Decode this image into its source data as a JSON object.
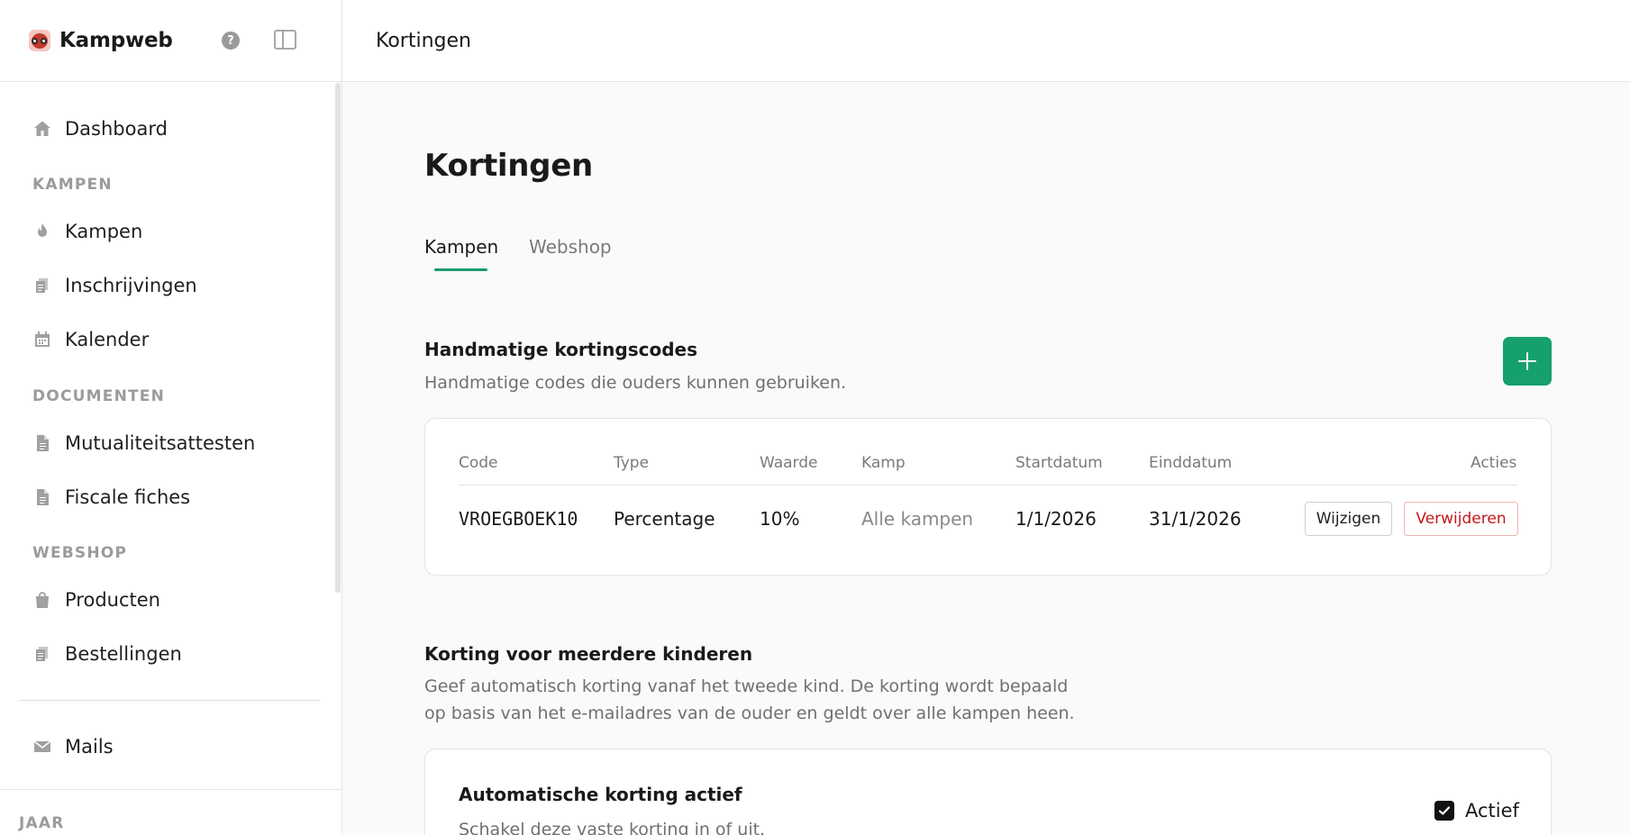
{
  "sidebar": {
    "brand": "Kampweb",
    "nav": {
      "dashboard": "Dashboard",
      "kampen": "Kampen",
      "inschrijvingen": "Inschrijvingen",
      "kalender": "Kalender",
      "mutualiteitsattesten": "Mutualiteitsattesten",
      "fiscale_fiches": "Fiscale fiches",
      "producten": "Producten",
      "bestellingen": "Bestellingen",
      "mails": "Mails"
    },
    "sections": {
      "kampen": "KAMPEN",
      "documenten": "DOCUMENTEN",
      "webshop": "WEBSHOP",
      "jaar": "JAAR"
    }
  },
  "topbar": {
    "title": "Kortingen"
  },
  "main": {
    "title": "Kortingen",
    "tabs": [
      {
        "label": "Kampen",
        "active": true
      },
      {
        "label": "Webshop",
        "active": false
      }
    ],
    "manual": {
      "title": "Handmatige kortingscodes",
      "description": "Handmatige codes die ouders kunnen gebruiken.",
      "columns": {
        "code": "Code",
        "type": "Type",
        "value": "Waarde",
        "camp": "Kamp",
        "start": "Startdatum",
        "end": "Einddatum",
        "actions": "Acties"
      },
      "rows": [
        {
          "code": "VROEGBOEK10",
          "type": "Percentage",
          "value": "10%",
          "camp": "Alle kampen",
          "start": "1/1/2026",
          "end": "31/1/2026",
          "edit": "Wijzigen",
          "delete": "Verwijderen"
        }
      ]
    },
    "multi": {
      "title": "Korting voor meerdere kinderen",
      "description_line1": "Geef automatisch korting vanaf het tweede kind. De korting wordt bepaald",
      "description_line2": "op basis van het e-mailadres van de ouder en geldt over alle kampen heen.",
      "auto_title": "Automatische korting actief",
      "auto_description": "Schakel deze vaste korting in of uit.",
      "checkbox_label": "Actief",
      "checked": true
    }
  },
  "colors": {
    "accent": "#16a06b",
    "danger": "#c4161c",
    "background": "#fafafa"
  }
}
